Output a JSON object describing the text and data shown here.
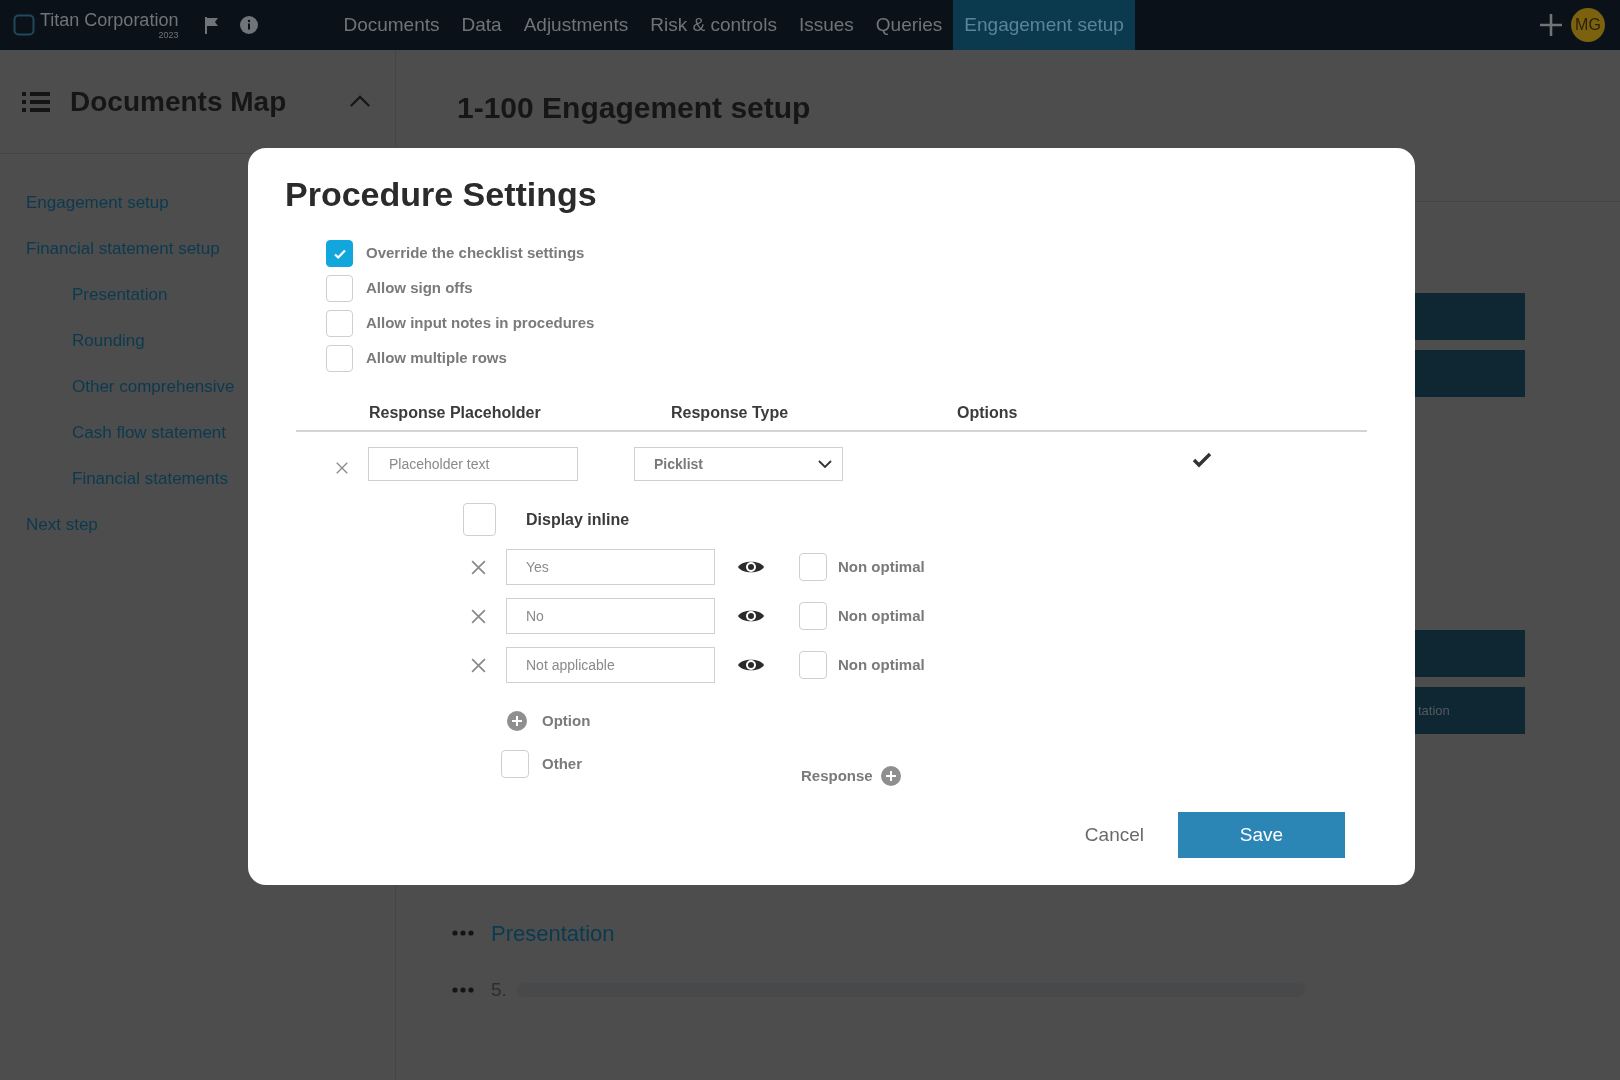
{
  "app_bar": {
    "brand": "Titan Corporation",
    "year": "2023",
    "avatar": "MG",
    "nav": [
      {
        "label": "Documents",
        "selected": false
      },
      {
        "label": "Data",
        "selected": false
      },
      {
        "label": "Adjustments",
        "selected": false
      },
      {
        "label": "Risk & controls",
        "selected": false
      },
      {
        "label": "Issues",
        "selected": false
      },
      {
        "label": "Queries",
        "selected": false
      },
      {
        "label": "Engagement setup",
        "selected": true
      }
    ]
  },
  "sidebar": {
    "title": "Documents Map",
    "items": [
      {
        "label": "Engagement setup"
      },
      {
        "label": "Financial statement setup",
        "children": [
          {
            "label": "Presentation"
          },
          {
            "label": "Rounding"
          },
          {
            "label": "Other comprehensive"
          },
          {
            "label": "Cash flow statement"
          },
          {
            "label": "Financial statements"
          }
        ]
      },
      {
        "label": "Next step"
      }
    ]
  },
  "page": {
    "title": "1-100 Engagement setup",
    "button_text": "tation",
    "sections": [
      {
        "label": "Presentation"
      }
    ],
    "rows": [
      {
        "number": "5."
      }
    ]
  },
  "dialog": {
    "title": "Procedure Settings",
    "settings": [
      {
        "label": "Override the checklist settings",
        "checked": true
      },
      {
        "label": "Allow sign offs",
        "checked": false
      },
      {
        "label": "Allow input notes in procedures",
        "checked": false
      },
      {
        "label": "Allow multiple rows",
        "checked": false
      }
    ],
    "columns": [
      "Response Placeholder",
      "Response Type",
      "Options"
    ],
    "response": {
      "placeholder": "Placeholder text",
      "type": "Picklist"
    },
    "display_inline": {
      "label": "Display inline",
      "checked": false
    },
    "options": [
      {
        "value": "Yes",
        "flag_label": "Non optimal",
        "non_optimal": false
      },
      {
        "value": "No",
        "flag_label": "Non optimal",
        "non_optimal": false
      },
      {
        "value": "Not applicable",
        "flag_label": "Non optimal",
        "non_optimal": false
      }
    ],
    "add_option": "Option",
    "other": {
      "label": "Other",
      "checked": false
    },
    "add_response": "Response",
    "buttons": {
      "cancel": "Cancel",
      "save": "Save"
    }
  }
}
